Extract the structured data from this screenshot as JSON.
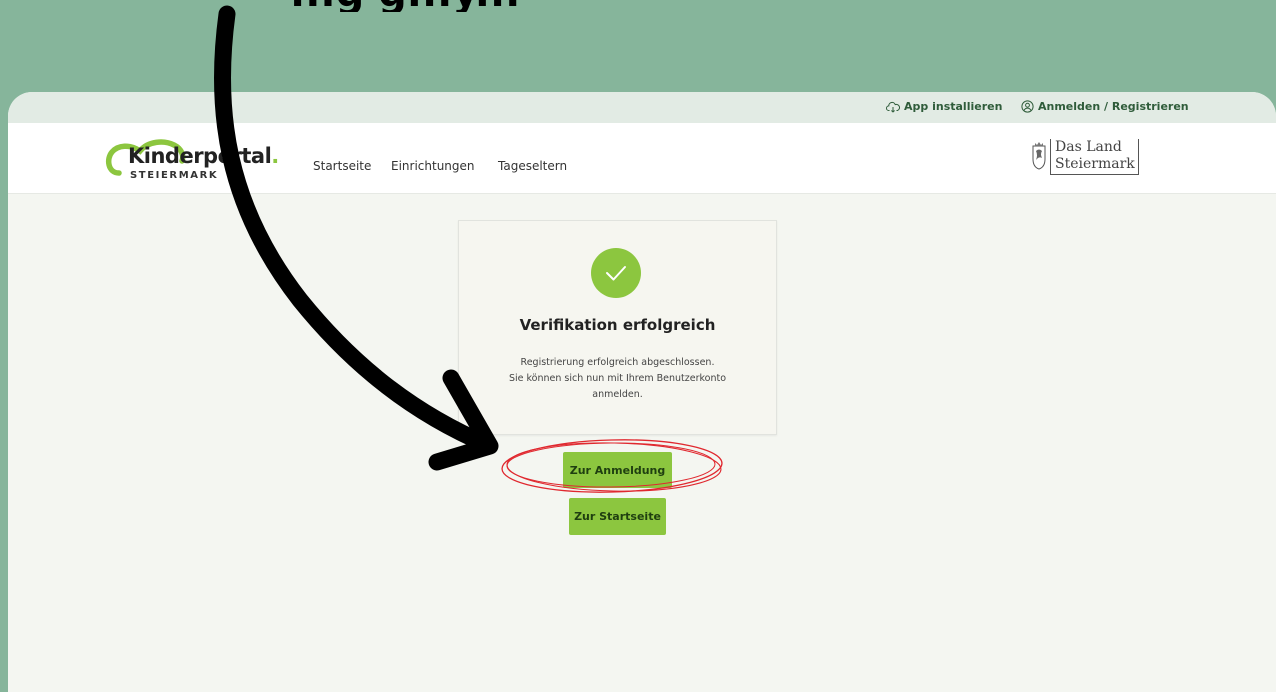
{
  "headline": "...g g...y...",
  "topbar": {
    "install_label": "App installieren",
    "login_label": "Anmelden / Registrieren"
  },
  "navbar": {
    "logo_name": "Kinderportal",
    "logo_dot": ".",
    "logo_sub": "STEIERMARK",
    "items": [
      {
        "label": "Startseite"
      },
      {
        "label": "Einrichtungen"
      },
      {
        "label": "Tageseltern"
      }
    ],
    "land_logo_line1": "Das Land",
    "land_logo_line2": "Steiermark"
  },
  "card": {
    "title": "Verifikation erfolgreich",
    "text_lines": [
      "Registrierung erfolgreich abgeschlossen.",
      "Sie können sich nun mit Ihrem Benutzerkonto",
      "anmelden."
    ]
  },
  "buttons": {
    "login": "Zur Anmeldung",
    "home": "Zur Startseite"
  },
  "colors": {
    "background": "#86b59b",
    "brand_green": "#8cc63f",
    "annotation_red": "#e0282f",
    "arrow": "#000000"
  },
  "icons": [
    "cloud-download-icon",
    "user-circle-icon",
    "checkmark-icon",
    "coat-of-arms-icon",
    "arrow-annotation-icon",
    "circle-annotation-icon"
  ]
}
